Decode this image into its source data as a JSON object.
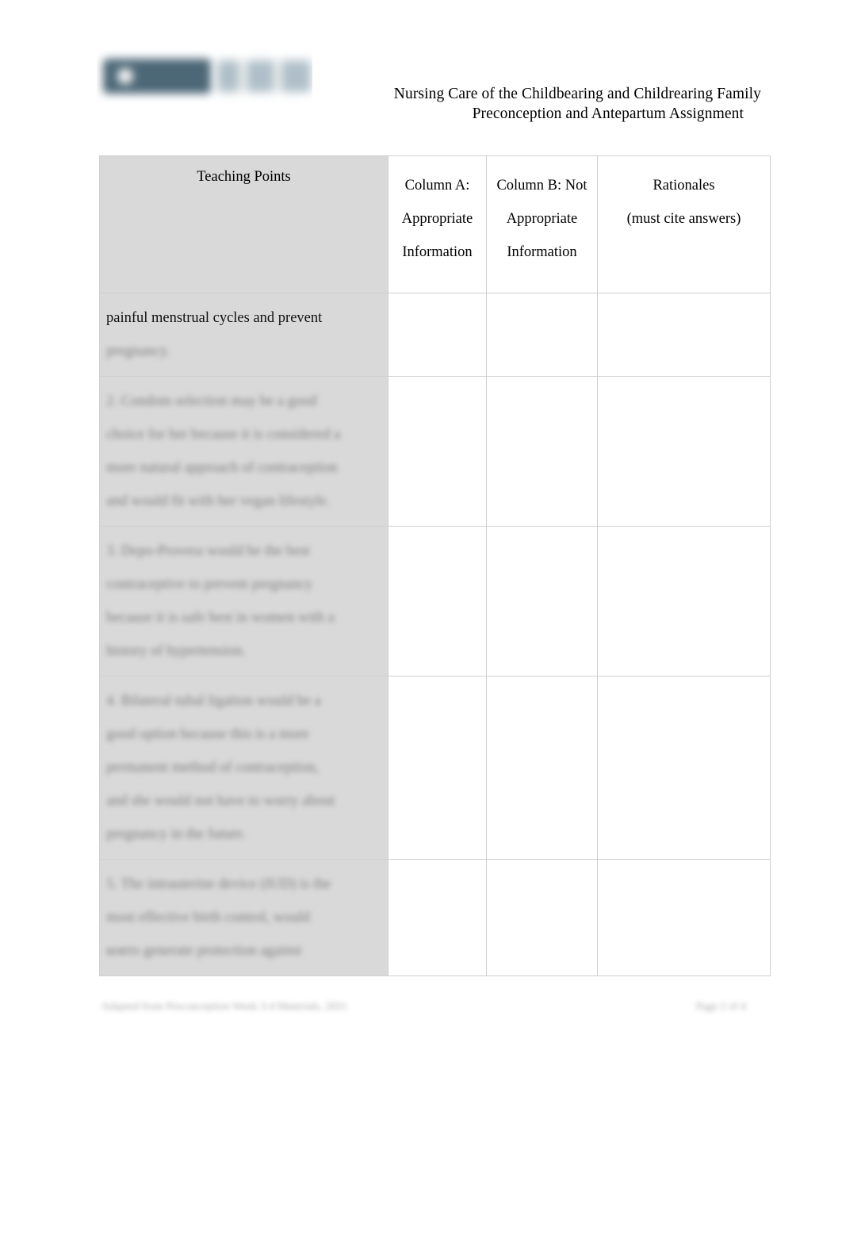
{
  "document": {
    "header": {
      "logo_alt": "institution-logo",
      "logo_primary_color": "#3f5c6c",
      "logo_secondary_color": "#a4b6c1",
      "title_line1": "Nursing Care of the Childbearing and Childrearing Family",
      "title_line2": "Preconception and Antepartum Assignment"
    },
    "table": {
      "columns": [
        {
          "key": "teaching_points",
          "label": "Teaching Points",
          "lines": [
            "Teaching Points"
          ],
          "shaded": true,
          "shade_color": "#d9d9d9"
        },
        {
          "key": "column_a",
          "label": "Column A: Appropriate Information",
          "lines": [
            "Column A:",
            "Appropriate",
            "Information"
          ],
          "shaded": false
        },
        {
          "key": "column_b",
          "label": "Column B: Not Appropriate Information",
          "lines": [
            "Column B: Not",
            "Appropriate",
            "Information"
          ],
          "shaded": false
        },
        {
          "key": "rationales",
          "label": "Rationales (must cite answers)",
          "lines": [
            "Rationales",
            "(must cite answers)"
          ],
          "shaded": false
        }
      ],
      "rows": [
        {
          "id": "row-1",
          "teaching_point_lines": [
            {
              "text": "painful menstrual cycles and prevent",
              "redacted": false
            },
            {
              "text": "pregnancy.",
              "redacted": true
            }
          ],
          "column_a": "",
          "column_b": "",
          "rationales": ""
        },
        {
          "id": "row-2",
          "teaching_point_lines": [
            {
              "text": "2. Condom selection may be a good",
              "redacted": true
            },
            {
              "text": "choice for her because it is considered a",
              "redacted": true
            },
            {
              "text": "more natural approach of contraception",
              "redacted": true
            },
            {
              "text": "and would fit with her vegan lifestyle.",
              "redacted": true
            }
          ],
          "column_a": "",
          "column_b": "",
          "rationales": ""
        },
        {
          "id": "row-3",
          "teaching_point_lines": [
            {
              "text": "3. Depo-Provera would be the best",
              "redacted": true
            },
            {
              "text": "contraceptive to prevent pregnancy",
              "redacted": true
            },
            {
              "text": "because it is safe best in women with a",
              "redacted": true
            },
            {
              "text": "history of hypertension.",
              "redacted": true
            }
          ],
          "column_a": "",
          "column_b": "",
          "rationales": ""
        },
        {
          "id": "row-4",
          "teaching_point_lines": [
            {
              "text": "4. Bilateral tubal ligation would be a",
              "redacted": true
            },
            {
              "text": "good option because this is a more",
              "redacted": true
            },
            {
              "text": "permanent method of contraception,",
              "redacted": true
            },
            {
              "text": "and she would not have to worry about",
              "redacted": true
            },
            {
              "text": "pregnancy in the future.",
              "redacted": true
            }
          ],
          "column_a": "",
          "column_b": "",
          "rationales": ""
        },
        {
          "id": "row-5",
          "teaching_point_lines": [
            {
              "text": "5. The intrauterine device (IUD) is the",
              "redacted": true
            },
            {
              "text": "most effective birth control, would",
              "redacted": true
            },
            {
              "text": "която generate protection against",
              "redacted": true
            }
          ],
          "column_a": "",
          "column_b": "",
          "rationales": ""
        }
      ]
    },
    "footer": {
      "left_text": "Adapted from Preconception Week 3-4 Materials, 2021",
      "right_text": "Page 2 of 4"
    }
  }
}
